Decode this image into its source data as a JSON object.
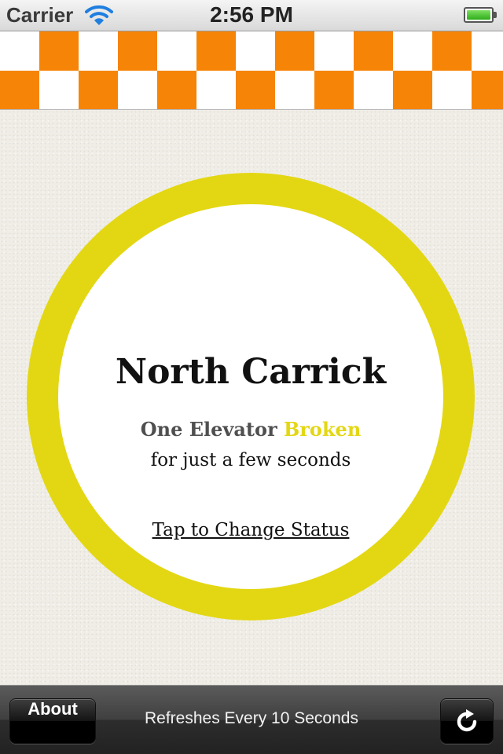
{
  "status_bar": {
    "carrier": "Carrier",
    "time": "2:56 PM",
    "wifi_icon": "wifi-icon",
    "battery_icon": "battery-icon",
    "battery_level": 1.0
  },
  "banner": {
    "pattern": "checkered",
    "colors": {
      "primary": "#f68406",
      "secondary": "#ffffff"
    }
  },
  "status_card": {
    "building": "North Carrick",
    "status_count": "One Elevator",
    "status_word": "Broken",
    "duration": "for just a few seconds",
    "action_label": "Tap to Change Status",
    "ring_color": "#e3d713"
  },
  "toolbar": {
    "about_label": "About",
    "refresh_note": "Refreshes Every 10 Seconds",
    "refresh_icon": "refresh-icon"
  }
}
